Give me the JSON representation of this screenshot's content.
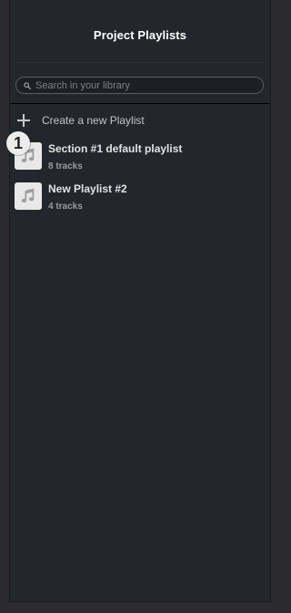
{
  "header": {
    "title": "Project Playlists"
  },
  "search": {
    "placeholder": "Search in your library",
    "value": ""
  },
  "create": {
    "label": "Create a new Playlist"
  },
  "playlists": [
    {
      "name": "Section #1 default playlist",
      "count": "8 tracks"
    },
    {
      "name": "New Playlist #2",
      "count": "4 tracks"
    }
  ],
  "overlay": {
    "step_badge": "1"
  },
  "icons": {
    "search": "search-icon",
    "plus": "plus-icon",
    "playlist": "music-note-icon"
  }
}
